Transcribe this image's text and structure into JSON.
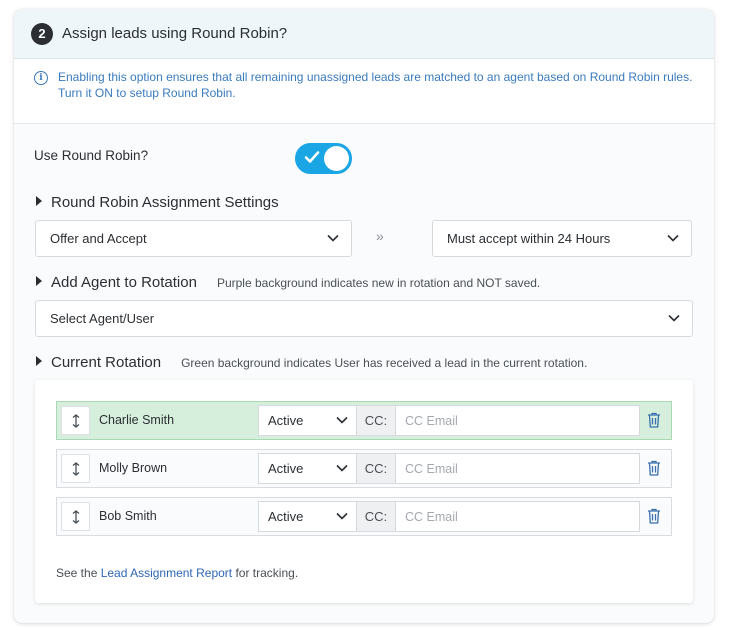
{
  "header": {
    "step": "2",
    "title": "Assign leads using Round Robin?"
  },
  "info": {
    "line1": "Enabling this option ensures that all remaining unassigned leads are matched to an agent based on Round Robin rules.",
    "line2": "Turn it ON to setup Round Robin."
  },
  "use_round_robin": {
    "label": "Use Round Robin?",
    "enabled": true
  },
  "assignment_settings": {
    "title": "Round Robin Assignment Settings",
    "mode_select": "Offer and Accept",
    "arrows": "»",
    "time_select": "Must accept within 24 Hours"
  },
  "add_agent": {
    "title": "Add Agent to Rotation",
    "note": "Purple background indicates new in rotation and NOT saved.",
    "select_placeholder": "Select Agent/User"
  },
  "current_rotation": {
    "title": "Current Rotation",
    "note": "Green background indicates User has received a lead in the current rotation.",
    "rows": [
      {
        "name": "Charlie Smith",
        "status": "Active",
        "cc_label": "CC:",
        "cc_placeholder": "CC Email",
        "received": true
      },
      {
        "name": "Molly Brown",
        "status": "Active",
        "cc_label": "CC:",
        "cc_placeholder": "CC Email",
        "received": false
      },
      {
        "name": "Bob Smith",
        "status": "Active",
        "cc_label": "CC:",
        "cc_placeholder": "CC Email",
        "received": false
      }
    ],
    "footer_prefix": "See the ",
    "footer_link": "Lead Assignment Report",
    "footer_suffix": " for tracking."
  },
  "colors": {
    "toggle_on": "#1aa6e5",
    "info_text": "#3a7bbd",
    "received_row": "#d6efdc",
    "link": "#2f67b5",
    "trash": "#3a6fb0"
  },
  "icons": {
    "info": "info-circle-icon",
    "toggle_check": "check-icon",
    "dropdown": "chevron-down-icon",
    "drag": "drag-handle-icon",
    "delete": "trash-icon"
  }
}
